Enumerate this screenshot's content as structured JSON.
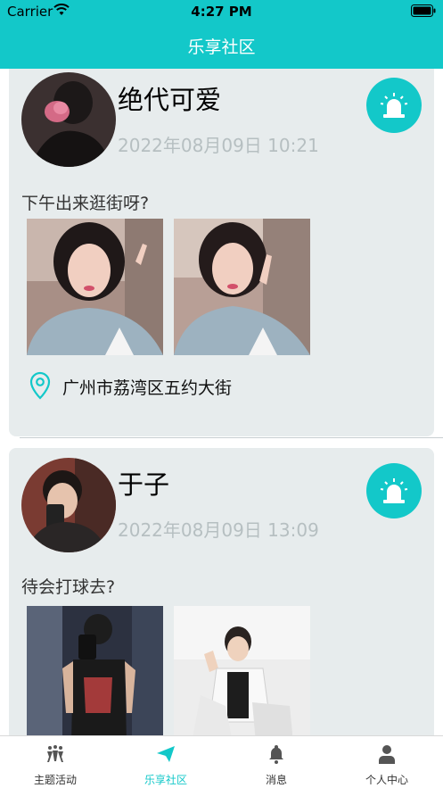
{
  "status_bar": {
    "carrier": "Carrier",
    "time": "4:27 PM"
  },
  "nav": {
    "title": "乐享社区"
  },
  "posts": [
    {
      "author": "绝代可爱",
      "time": "2022年08月09日  10:21",
      "text": "下午出来逛街呀?",
      "location": "广州市荔湾区五约大街"
    },
    {
      "author": "于子",
      "time": "2022年08月09日  13:09",
      "text": "待会打球去?"
    }
  ],
  "tabs": [
    {
      "label": "主题活动",
      "icon": "activity-icon",
      "active": false
    },
    {
      "label": "乐享社区",
      "icon": "paper-plane-icon",
      "active": true
    },
    {
      "label": "消息",
      "icon": "bell-icon",
      "active": false
    },
    {
      "label": "个人中心",
      "icon": "person-icon",
      "active": false
    }
  ],
  "colors": {
    "accent": "#13c8c9",
    "card_bg": "#e7eced",
    "muted_text": "#b6bfc1"
  }
}
